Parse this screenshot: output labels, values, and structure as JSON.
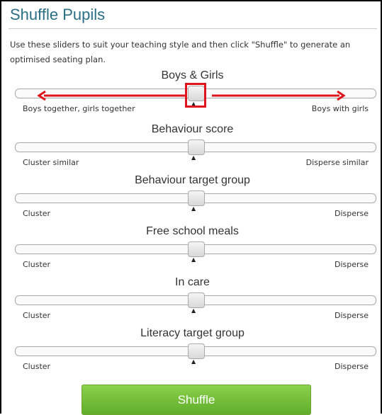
{
  "page": {
    "title": "Shuffle Pupils",
    "intro": "Use these sliders to suit your teaching style and then click \"Shuffle\" to generate an optimised seating plan."
  },
  "sliders": [
    {
      "title": "Boys & Girls",
      "left_label": "Boys together, girls together",
      "right_label": "Boys with girls",
      "value": 0.5
    },
    {
      "title": "Behaviour score",
      "left_label": "Cluster similar",
      "right_label": "Disperse similar",
      "value": 0.5
    },
    {
      "title": "Behaviour target group",
      "left_label": "Cluster",
      "right_label": "Disperse",
      "value": 0.5
    },
    {
      "title": "Free school meals",
      "left_label": "Cluster",
      "right_label": "Disperse",
      "value": 0.5
    },
    {
      "title": "In care",
      "left_label": "Cluster",
      "right_label": "Disperse",
      "value": 0.5
    },
    {
      "title": "Literacy target group",
      "left_label": "Cluster",
      "right_label": "Disperse",
      "value": 0.5
    }
  ],
  "shuffle_button": {
    "label": "Shuffle"
  },
  "colors": {
    "title": "#2b6f87",
    "annotation": "#e0141c",
    "button": "#6cbb35"
  },
  "icons": {
    "caret": "caret-up-icon",
    "arrows": "arrow-left-icon, arrow-right-icon"
  }
}
